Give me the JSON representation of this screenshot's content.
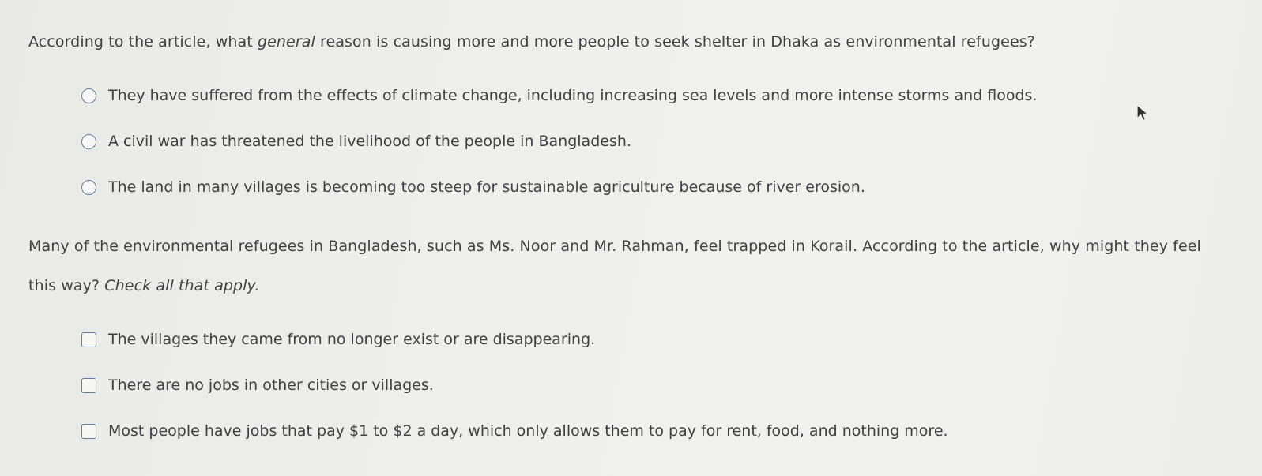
{
  "question1": {
    "prompt_before": "According to the article, what ",
    "prompt_emphasis": "general",
    "prompt_after": " reason is causing more and more people to seek shelter in Dhaka as environmental refugees?",
    "options": [
      "They have suffered from the effects of climate change, including increasing sea levels and more intense storms and floods.",
      "A civil war has threatened the livelihood of the people in Bangladesh.",
      "The land in many villages is becoming too steep for sustainable agriculture because of river erosion."
    ]
  },
  "question2": {
    "prompt": "Many of the environmental refugees in Bangladesh, such as Ms. Noor and Mr. Rahman, feel trapped in Korail. According to the article, why might they feel this way? ",
    "instruction": "Check all that apply.",
    "options": [
      "The villages they came from no longer exist or are disappearing.",
      "There are no jobs in other cities or villages.",
      "Most people have jobs that pay $1 to $2 a day, which only allows them to pay for rent, food, and nothing more."
    ]
  },
  "icons": {
    "cursor": "mouse-pointer-icon",
    "radio": "radio-button-icon",
    "checkbox": "checkbox-icon"
  }
}
